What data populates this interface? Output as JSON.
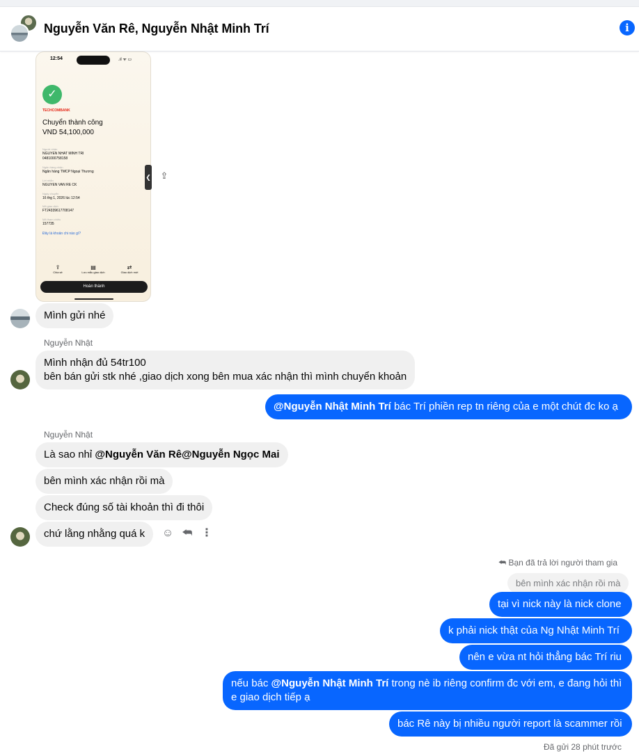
{
  "header": {
    "title": "Nguyễn Văn Rê, Nguyễn Nhật Minh Trí",
    "info_icon": "i"
  },
  "attachment": {
    "status_time": "12:54",
    "status_icons": ".ıl ᯤ ▭",
    "bank": "TECHCOMBANK",
    "heading": "Chuyển thành công",
    "amount": "VND 54,100,000",
    "fields": [
      {
        "label": "Người nhận",
        "value": "NGUYEN NHAT MINH TRI\n0481000758158"
      },
      {
        "label": "Ngân hàng nhận",
        "value": "Ngân hàng TMCP Ngoại Thương"
      },
      {
        "label": "Lời nhắn",
        "value": "NGUYEN VAN RE CK"
      },
      {
        "label": "Ngày chuyển",
        "value": "16 thg 1, 2026 lúc 12:54"
      },
      {
        "label": "Mã giao dịch",
        "value": "FT24339617708147"
      },
      {
        "label": "Mã tham chiếu",
        "value": "157735"
      }
    ],
    "link": "Đây là khoản chi nào gì?",
    "actions": [
      "Chia sẻ",
      "Lưu mẫu giao dịch",
      "Giao dịch mới"
    ],
    "done_button": "Hoàn thành"
  },
  "messages": {
    "m1": "Mình gửi nhé",
    "sender1": "Nguyễn Nhật",
    "m2_line1": "Mình nhận đủ 54tr100",
    "m2_line2": "bên bán gửi stk nhé ,giao dịch xong bên mua xác nhận thì mình chuyển khoản",
    "out1_mention": "@Nguyễn Nhật Minh Trí",
    "out1_text": " bác Trí phiền rep tn riêng của e một chút đc ko ạ",
    "sender2": "Nguyễn Nhật",
    "m3_prefix": "Là sao nhỉ ",
    "m3_mention1": "@Nguyễn Văn Rê",
    "m3_mention2": "@Nguyễn Ngọc Mai",
    "m4": "bên mình xác nhận rồi mà",
    "m5": "Check đúng số tài khoản thì đi thôi",
    "m6": "chứ lằng nhằng quá k",
    "reply_note": "Bạn đã trả lời người tham gia",
    "quoted": "bên mình xác nhận rồi mà",
    "out2": "tại vì nick này là nick clone",
    "out3": "k phải nick thật của Ng Nhật Minh Trí",
    "out4": "nên e vừa nt hỏi thẳng bác Trí riu",
    "out5_prefix": "nếu bác ",
    "out5_mention": "@Nguyễn Nhật Minh Trí",
    "out5_rest": " trong nè ib riêng confirm đc với em, e đang hỏi thì",
    "out5_line2": "e giao dịch tiếp ạ",
    "out6": "bác Rê này bị nhiều người report là scammer rồi",
    "sent_status": "Đã gửi 28 phút trước"
  },
  "icons": {
    "reply_arrow": "reply-icon",
    "emoji": "emoji-icon",
    "more": "more-icon",
    "share": "share-icon"
  }
}
